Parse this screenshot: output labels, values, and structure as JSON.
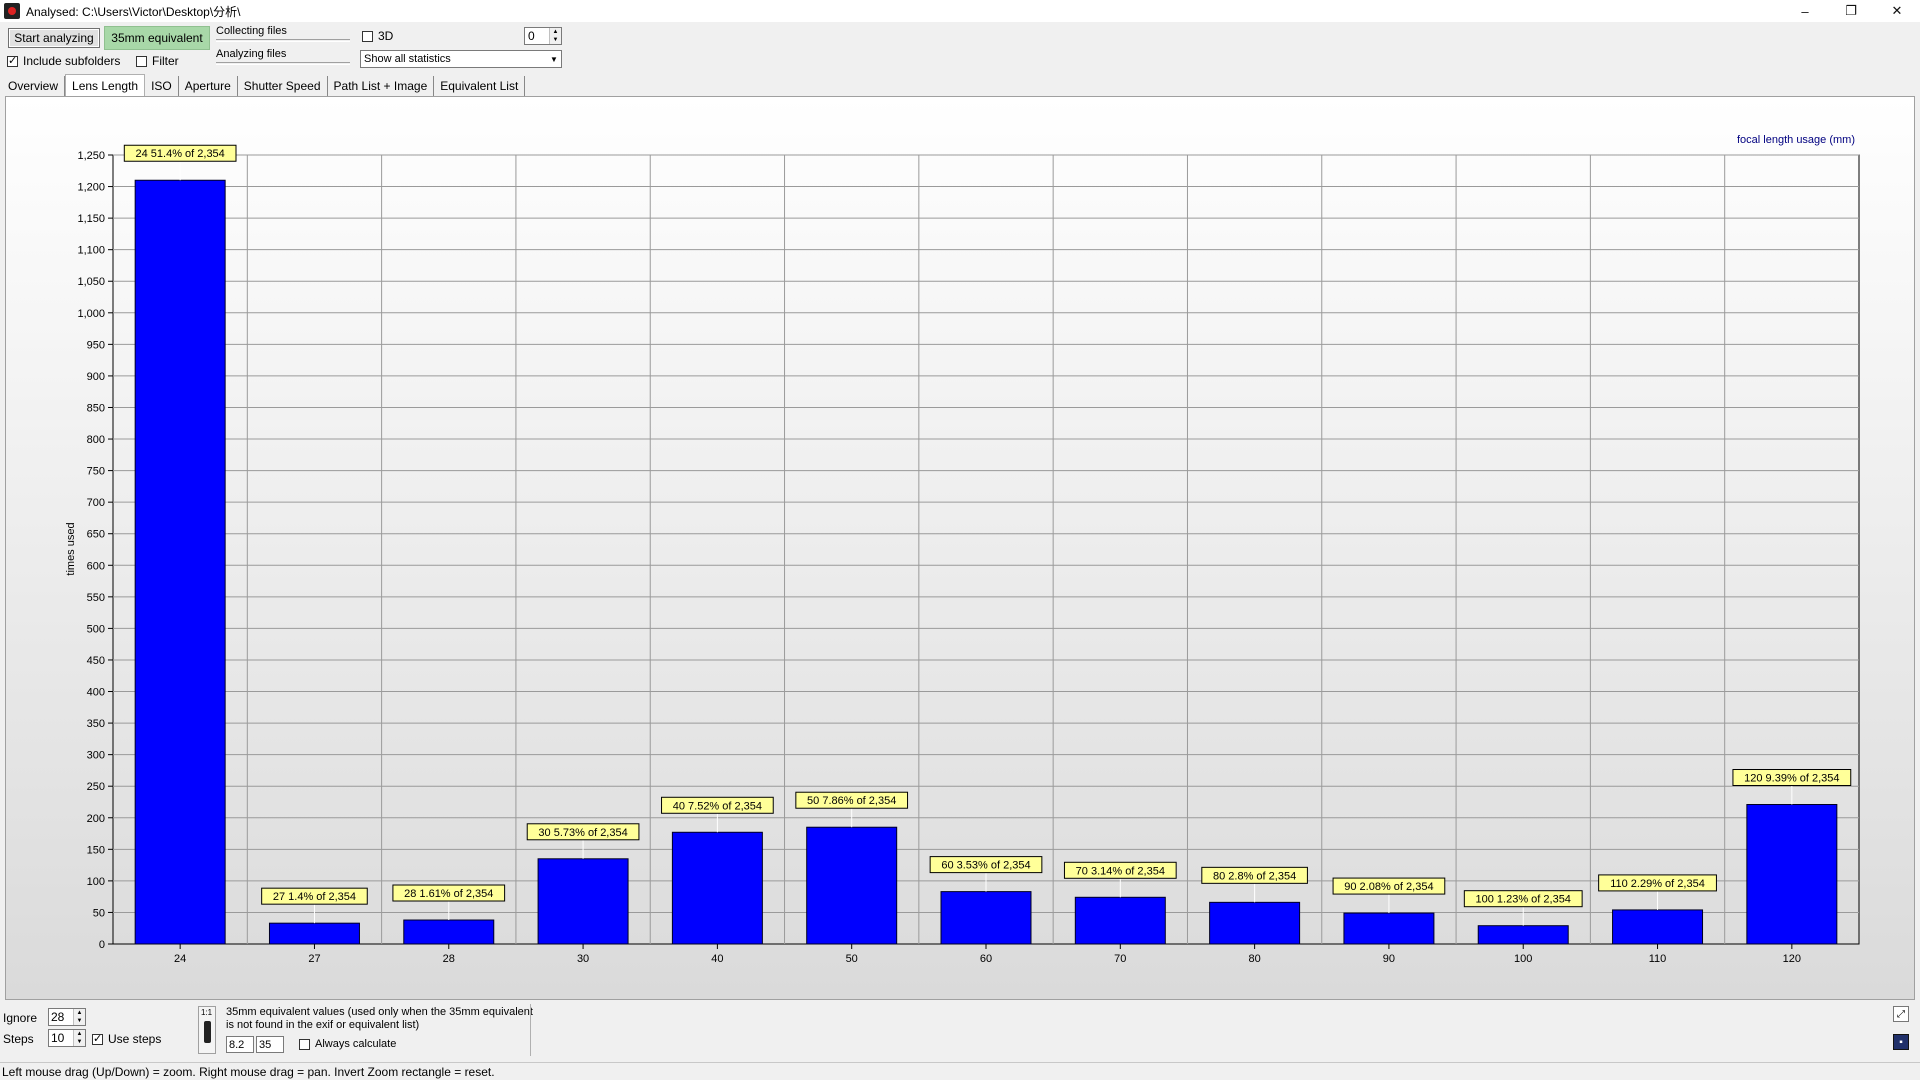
{
  "window": {
    "title": "Analysed: C:\\Users\\Victor\\Desktop\\分析\\"
  },
  "toolbar": {
    "start_label": "Start analyzing",
    "equiv_label": "35mm equivalent",
    "include_subfolders_label": "Include subfolders",
    "include_subfolders_checked": true,
    "filter_label": "Filter",
    "filter_checked": false,
    "collecting_label": "Collecting files",
    "analyzing_label": "Analyzing files",
    "three_d_label": "3D",
    "three_d_checked": false,
    "spin_value": "0",
    "stats_select_value": "Show all statistics"
  },
  "tabs": [
    {
      "label": "Overview",
      "active": false
    },
    {
      "label": "Lens Length",
      "active": true
    },
    {
      "label": "ISO",
      "active": false
    },
    {
      "label": "Aperture",
      "active": false
    },
    {
      "label": "Shutter Speed",
      "active": false
    },
    {
      "label": "Path List + Image",
      "active": false
    },
    {
      "label": "Equivalent List",
      "active": false
    }
  ],
  "chart_data": {
    "type": "bar",
    "title": "focal length usage (mm)",
    "ylabel": "times used",
    "xlabel": "",
    "categories": [
      "24",
      "27",
      "28",
      "30",
      "40",
      "50",
      "60",
      "70",
      "80",
      "90",
      "100",
      "110",
      "120"
    ],
    "values": [
      1210,
      33,
      38,
      135,
      177,
      185,
      83,
      74,
      66,
      49,
      29,
      54,
      221
    ],
    "data_labels": [
      "24 51.4% of 2,354",
      "27 1.4% of 2,354",
      "28 1.61% of 2,354",
      "30 5.73% of 2,354",
      "40 7.52% of 2,354",
      "50 7.86% of 2,354",
      "60 3.53% of 2,354",
      "70 3.14% of 2,354",
      "80 2.8% of 2,354",
      "90 2.08% of 2,354",
      "100 1.23% of 2,354",
      "110 2.29% of 2,354",
      "120 9.39% of 2,354"
    ],
    "yticks": [
      "0",
      "50",
      "100",
      "150",
      "200",
      "250",
      "300",
      "350",
      "400",
      "450",
      "500",
      "550",
      "600",
      "650",
      "700",
      "750",
      "800",
      "850",
      "900",
      "950",
      "1,000",
      "1,050",
      "1,100",
      "1,150",
      "1,200",
      "1,250"
    ],
    "ylim": [
      0,
      1250
    ],
    "grid": true,
    "bar_color": "#0000ff",
    "label_bg_color": "#ffff99",
    "title_color": "#000080"
  },
  "bottom": {
    "ignore_label": "Ignore",
    "ignore_value": "28",
    "steps_label": "Steps",
    "steps_value": "10",
    "use_steps_label": "Use steps",
    "use_steps_checked": true,
    "handle_tick": "1:1",
    "equiv_desc_line1": "35mm equivalent values (used only when the 35mm equivalent",
    "equiv_desc_line2": "is not found in the exif or equivalent list)",
    "equiv_value1": "8.2",
    "equiv_value2": "35",
    "always_calc_label": "Always calculate",
    "always_calc_checked": false
  },
  "status": {
    "text": "Left mouse drag (Up/Down) = zoom. Right mouse drag = pan. Invert Zoom rectangle = reset."
  },
  "icons": {
    "app": "aperture-app-icon",
    "minimize": "minimize-icon",
    "restore": "restore-icon",
    "close": "close-icon",
    "fit": "fit-view-icon",
    "save": "save-icon"
  }
}
